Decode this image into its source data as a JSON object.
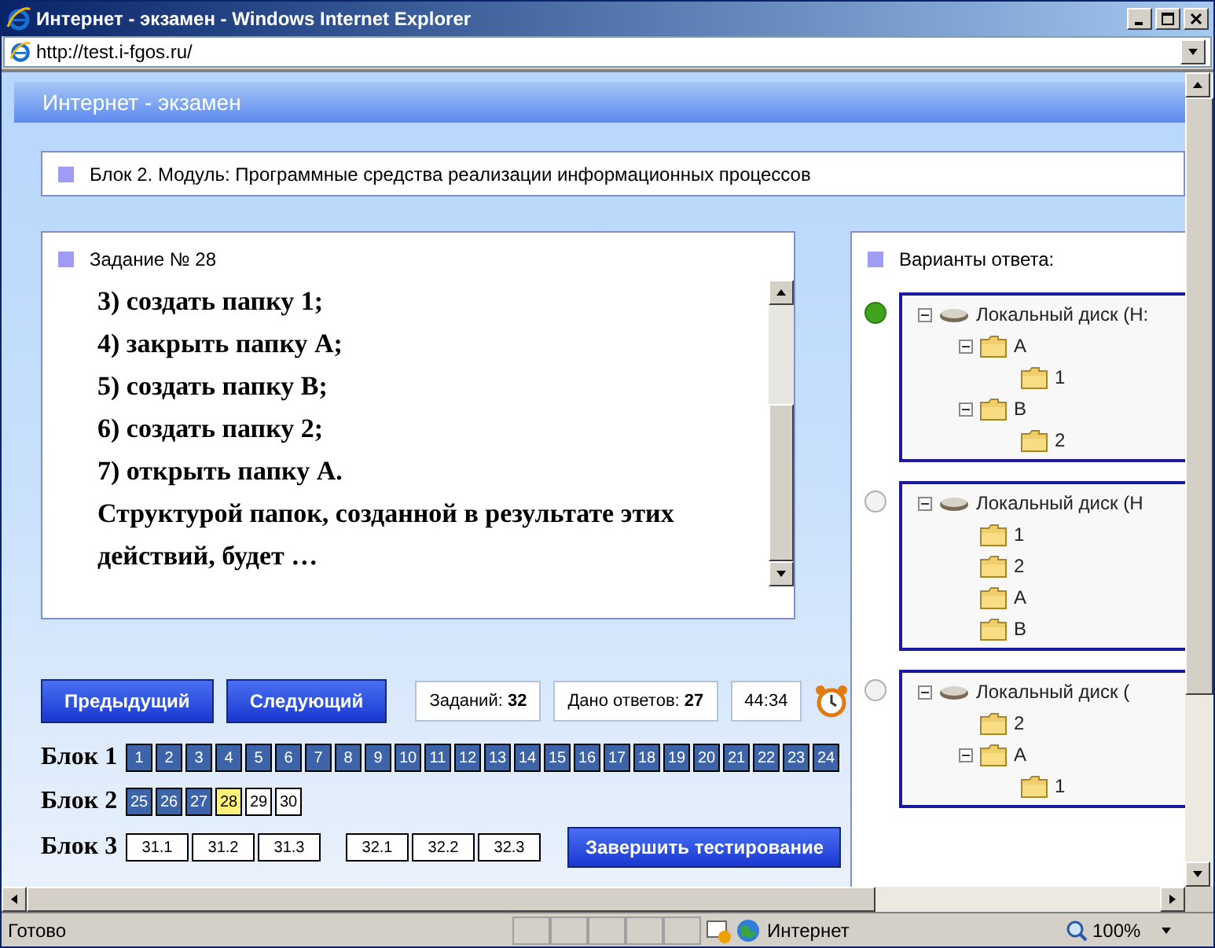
{
  "window": {
    "title": "Интернет - экзамен - Windows Internet Explorer"
  },
  "address_bar": {
    "url": "http://test.i-fgos.ru/"
  },
  "page": {
    "header": "Интернет - экзамен",
    "block_title": "Блок 2. Модуль: Программные средства реализации информационных процессов",
    "task": {
      "title": "Задание № 28",
      "lines": [
        "3) создать папку 1;",
        "4) закрыть папку А;",
        "5) создать папку В;",
        "6) создать папку 2;",
        "7) открыть папку А.",
        "Структурой папок, созданной в результате этих",
        "действий, будет …"
      ]
    },
    "answers": {
      "title": "Варианты ответа:",
      "options": [
        {
          "selected": true,
          "tree": [
            {
              "kind": "disk",
              "label": "Локальный диск (H:",
              "expanded": true,
              "children": [
                {
                  "kind": "folder",
                  "label": "A",
                  "expanded": true,
                  "children": [
                    {
                      "kind": "folder",
                      "label": "1"
                    }
                  ]
                },
                {
                  "kind": "folder",
                  "label": "B",
                  "expanded": true,
                  "children": [
                    {
                      "kind": "folder",
                      "label": "2"
                    }
                  ]
                }
              ]
            }
          ]
        },
        {
          "selected": false,
          "tree": [
            {
              "kind": "disk",
              "label": "Локальный диск (H",
              "expanded": true,
              "children": [
                {
                  "kind": "folder",
                  "label": "1"
                },
                {
                  "kind": "folder",
                  "label": "2"
                },
                {
                  "kind": "folder",
                  "label": "A"
                },
                {
                  "kind": "folder",
                  "label": "B"
                }
              ]
            }
          ]
        },
        {
          "selected": false,
          "tree": [
            {
              "kind": "disk",
              "label": "Локальный диск (",
              "expanded": true,
              "children": [
                {
                  "kind": "folder",
                  "label": "2"
                },
                {
                  "kind": "folder",
                  "label": "A",
                  "expanded": true,
                  "children": [
                    {
                      "kind": "folder",
                      "label": "1"
                    }
                  ]
                }
              ]
            }
          ]
        }
      ]
    },
    "prev_button": "Предыдущий",
    "next_button": "Следующий",
    "tasks_count": "Заданий: **32**",
    "answered_count": "Дано ответов: **27**",
    "timer": "44:34",
    "blocks": [
      {
        "label": "Блок 1",
        "groups": [
          [
            {
              "label": "1",
              "answered": true,
              "selected": false
            },
            {
              "label": "2",
              "answered": true,
              "selected": false
            },
            {
              "label": "3",
              "answered": true,
              "selected": false
            },
            {
              "label": "4",
              "answered": true,
              "selected": false
            },
            {
              "label": "5",
              "answered": true,
              "selected": false
            },
            {
              "label": "6",
              "answered": true,
              "selected": false
            },
            {
              "label": "7",
              "answered": true,
              "selected": false
            },
            {
              "label": "8",
              "answered": true,
              "selected": false
            },
            {
              "label": "9",
              "answered": true,
              "selected": false
            },
            {
              "label": "10",
              "answered": true,
              "selected": false
            },
            {
              "label": "11",
              "answered": true,
              "selected": false
            },
            {
              "label": "12",
              "answered": true,
              "selected": false
            },
            {
              "label": "13",
              "answered": true,
              "selected": false
            },
            {
              "label": "14",
              "answered": true,
              "selected": false
            },
            {
              "label": "15",
              "answered": true,
              "selected": false
            },
            {
              "label": "16",
              "answered": true,
              "selected": false
            },
            {
              "label": "17",
              "answered": true,
              "selected": false
            },
            {
              "label": "18",
              "answered": true,
              "selected": false
            },
            {
              "label": "19",
              "answered": true,
              "selected": false
            },
            {
              "label": "20",
              "answered": true,
              "selected": false
            },
            {
              "label": "21",
              "answered": true,
              "selected": false
            },
            {
              "label": "22",
              "answered": true,
              "selected": false
            },
            {
              "label": "23",
              "answered": true,
              "selected": false
            },
            {
              "label": "24",
              "answered": true,
              "selected": false
            }
          ]
        ]
      },
      {
        "label": "Блок 2",
        "groups": [
          [
            {
              "label": "25",
              "answered": true,
              "selected": false
            },
            {
              "label": "26",
              "answered": true,
              "selected": false
            },
            {
              "label": "27",
              "answered": true,
              "selected": false
            },
            {
              "label": "28",
              "answered": false,
              "selected": true
            },
            {
              "label": "29",
              "answered": false,
              "selected": false
            },
            {
              "label": "30",
              "answered": false,
              "selected": false
            }
          ]
        ]
      },
      {
        "label": "Блок 3",
        "groups": [
          [
            {
              "label": "31.1",
              "answered": false,
              "selected": false
            },
            {
              "label": "31.2",
              "answered": false,
              "selected": false
            },
            {
              "label": "31.3",
              "answered": false,
              "selected": false
            }
          ],
          [
            {
              "label": "32.1",
              "answered": false,
              "selected": false
            },
            {
              "label": "32.2",
              "answered": false,
              "selected": false
            },
            {
              "label": "32.3",
              "answered": false,
              "selected": false
            }
          ]
        ]
      }
    ],
    "finish_button": "Завершить тестирование"
  },
  "status_bar": {
    "text": "Готово",
    "zone": "Интернет",
    "zoom": "100%"
  }
}
